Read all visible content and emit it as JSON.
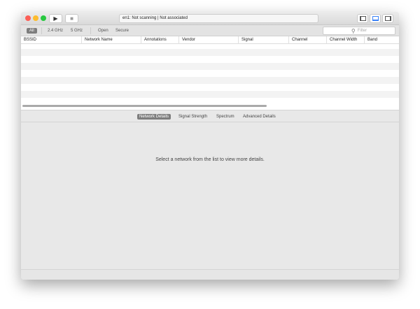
{
  "window": {
    "status_text": "en1: Not scanning  |  Not associated"
  },
  "toolbar": {
    "filters": [
      "All",
      "2.4 GHz",
      "5 GHz",
      "Open",
      "Secure"
    ],
    "selected": "All",
    "filter_placeholder": "Filter"
  },
  "table": {
    "columns": [
      "BSSID",
      "Network Name",
      "Annotations",
      "Vendor",
      "Signal",
      "Channel",
      "Channel Width",
      "Band"
    ]
  },
  "tabs": {
    "items": [
      "Network Details",
      "Signal Strength",
      "Spectrum",
      "Advanced Details"
    ],
    "selected": "Network Details"
  },
  "details": {
    "empty_message": "Select a network from the list to view more details."
  }
}
